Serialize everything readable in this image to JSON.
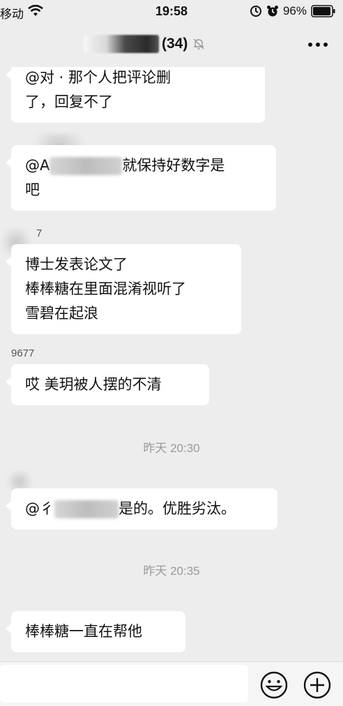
{
  "status_bar": {
    "carrier": "移动",
    "time": "19:58",
    "battery_percent": "96%",
    "battery_level": 0.96
  },
  "chat": {
    "title_suffix": "(34)"
  },
  "messages": [
    {
      "type": "message",
      "sender": "",
      "lines": [
        "@对   ·    那个人把评论删",
        "了，回复不了"
      ]
    },
    {
      "type": "message",
      "sender": "",
      "mention": "@A",
      "lines": [
        "就保持好数字是",
        "吧"
      ]
    },
    {
      "type": "message",
      "sender": "7",
      "lines": [
        "博士发表论文了",
        "棒棒糖在里面混淆视听了",
        "雪碧在起浪"
      ]
    },
    {
      "type": "message",
      "sender": "9677",
      "lines": [
        "哎 美玥被人摆的不清"
      ]
    },
    {
      "type": "time",
      "text": "昨天 20:30"
    },
    {
      "type": "message",
      "sender": "",
      "mention": "@彳",
      "lines": [
        "是的。优胜劣汰。"
      ]
    },
    {
      "type": "time",
      "text": "昨天 20:35"
    },
    {
      "type": "message",
      "sender": "",
      "lines": [
        "棒棒糖一直在帮他"
      ]
    }
  ],
  "input": {
    "value": "",
    "placeholder": ""
  },
  "icons": {
    "wifi": "wifi-icon",
    "location": "location-icon",
    "alarm": "alarm-icon",
    "battery": "battery-icon",
    "mute": "mute-bell-icon",
    "more": "more-dots-icon",
    "emoji": "emoji-icon",
    "add": "plus-icon"
  }
}
